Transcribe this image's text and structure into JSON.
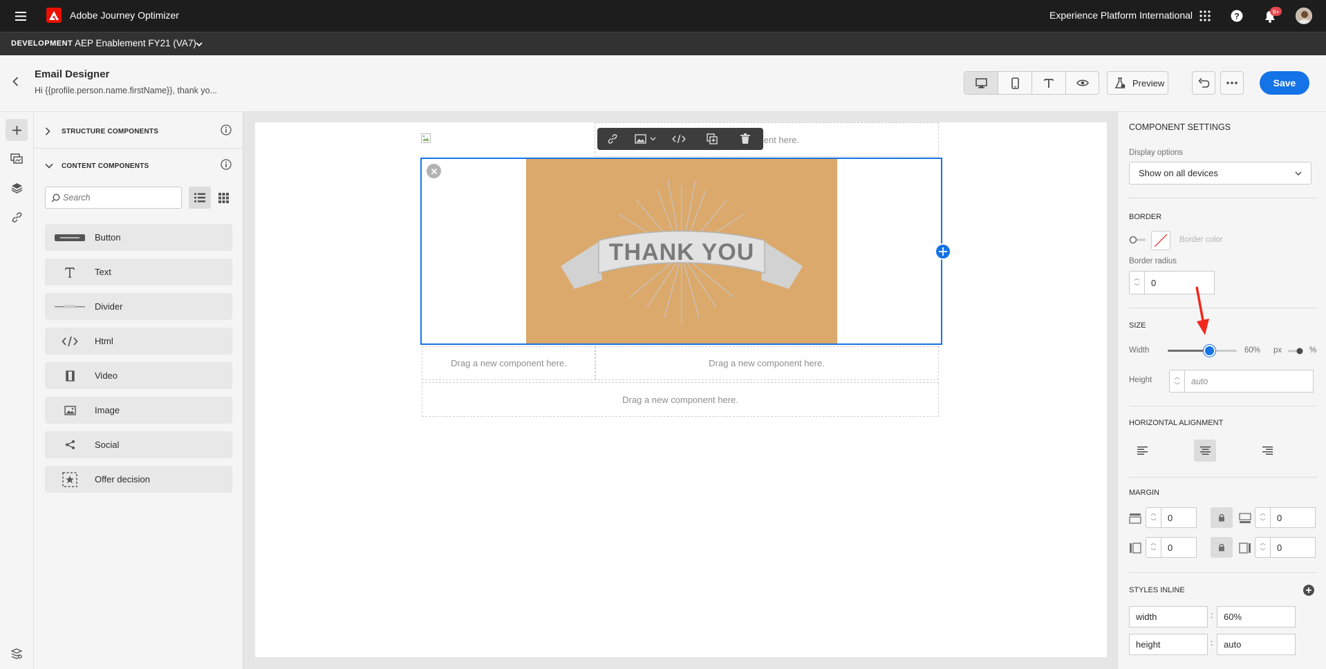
{
  "app": {
    "name": "Adobe Journey Optimizer",
    "org": "Experience Platform International",
    "notifications_badge": "9+",
    "env_label": "DEVELOPMENT",
    "sandbox": "AEP Enablement FY21 (VA7)"
  },
  "header": {
    "title": "Email Designer",
    "subtitle": "Hi {{profile.person.name.firstName}}, thank yo...",
    "preview_label": "Preview",
    "save_label": "Save"
  },
  "components_panel": {
    "structure_label": "STRUCTURE COMPONENTS",
    "content_label": "CONTENT COMPONENTS",
    "search_placeholder": "Search",
    "items": [
      {
        "label": "Button",
        "icon": "button-icon"
      },
      {
        "label": "Text",
        "icon": "text-icon"
      },
      {
        "label": "Divider",
        "icon": "divider-icon"
      },
      {
        "label": "Html",
        "icon": "code-icon"
      },
      {
        "label": "Video",
        "icon": "video-icon"
      },
      {
        "label": "Image",
        "icon": "image-icon"
      },
      {
        "label": "Social",
        "icon": "share-icon"
      },
      {
        "label": "Offer decision",
        "icon": "offer-decision-icon"
      }
    ]
  },
  "canvas": {
    "dropzone_text": "Drag a new component here.",
    "dropzone_partial": "omponent here.",
    "image_text": "THANK YOU",
    "image_bg": "#dba96b"
  },
  "settings": {
    "title": "COMPONENT SETTINGS",
    "display_label": "Display options",
    "display_value": "Show on all devices",
    "border_label": "BORDER",
    "border_color_label": "Border color",
    "border_radius_label": "Border radius",
    "border_radius_value": "0",
    "size_label": "SIZE",
    "width_label": "Width",
    "width_value": "60%",
    "width_fraction": 0.6,
    "unit_px": "px",
    "unit_pct": "%",
    "height_label": "Height",
    "height_placeholder": "auto",
    "halign_label": "HORIZONTAL ALIGNMENT",
    "margin_label": "MARGIN",
    "margin_top": "0",
    "margin_bottom": "0",
    "margin_left": "0",
    "margin_right": "0",
    "styles_label": "STYLES INLINE",
    "styles": [
      {
        "prop": "width",
        "value": "60%"
      },
      {
        "prop": "height",
        "value": "auto"
      }
    ]
  },
  "colors": {
    "accent": "#1473e6",
    "brand_red": "#eb1000",
    "annotation_arrow": "#f0281e"
  }
}
